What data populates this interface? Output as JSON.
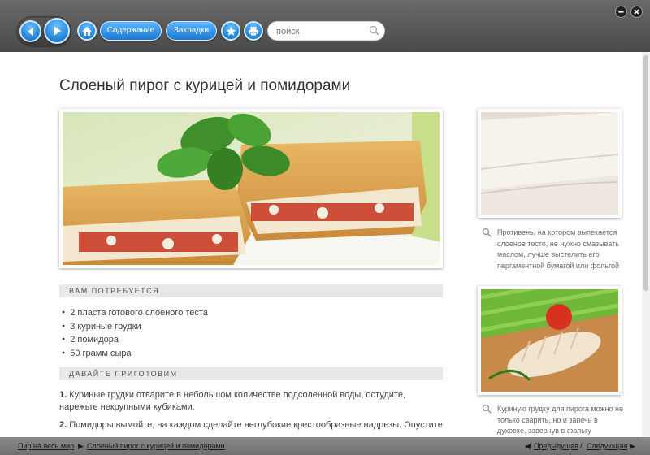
{
  "toolbar": {
    "contents_label": "Содержание",
    "bookmarks_label": "Закладки",
    "search_placeholder": "поиск"
  },
  "article": {
    "title": "Слоеный пирог с курицей и помидорами",
    "needs_heading": "ВАМ ПОТРЕБУЕТСЯ",
    "ingredients": [
      "2 пласта готового слоеного теста",
      "3 куриные грудки",
      "2 помидора",
      "50 грамм сыра"
    ],
    "prepare_heading": "ДАВАЙТЕ ПРИГОТОВИМ",
    "steps": [
      {
        "num": "1.",
        "text": "Куриные грудки отварите в небольшом количестве подсоленной воды, остудите, нарежьте некрупными кубиками."
      },
      {
        "num": "2.",
        "text": "Помидоры вымойте, на каждом сделайте неглубокие крестообразные надрезы. Опустите"
      }
    ]
  },
  "sidebar": {
    "captions": [
      "Противень, на котором выпекается слоеное тесто, не нужно смазывать маслом, лучше выстелить его пергаментной бумагой или фольгой",
      "Куриную грудку для пирога можно не только сварить, но и запечь в духовке, завернув в фольгу"
    ]
  },
  "footer": {
    "breadcrumb_root": "Пир на весь мир",
    "breadcrumb_current": "Слоеный пирог с курицей и помидорами",
    "prev_label": "Предыдущая",
    "separator": "/",
    "next_label": "Следующая"
  },
  "icons": {
    "back": "back-arrow-icon",
    "forward": "forward-arrow-icon",
    "home": "home-icon",
    "star": "star-icon",
    "print": "printer-icon",
    "search": "search-icon",
    "minimize": "minimize-icon",
    "close": "close-icon",
    "caption": "magnifier-icon"
  },
  "colors": {
    "toolbar": "#555555",
    "accent_blue": "#1f82d6",
    "section_bg": "#e8e8e8"
  }
}
